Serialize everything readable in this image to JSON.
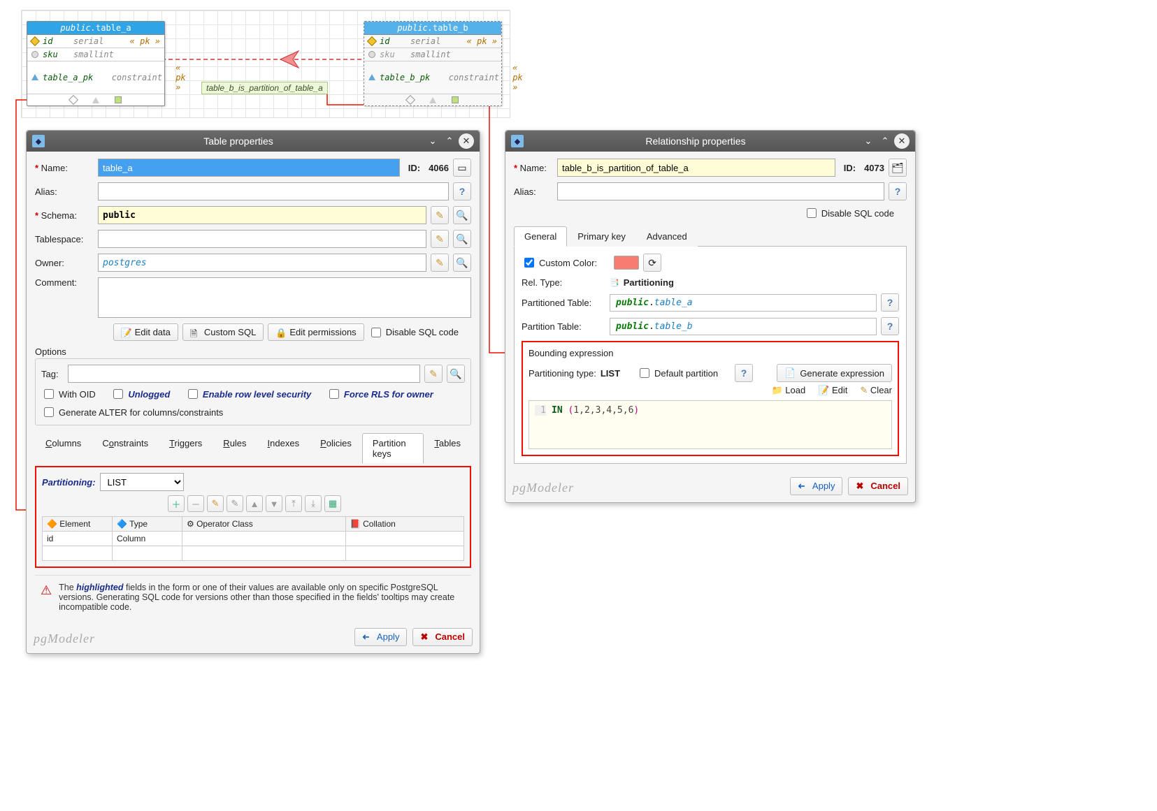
{
  "er": {
    "table_a": {
      "schema": "public.",
      "name": "table_a",
      "cols": [
        {
          "icon": "diamond",
          "name": "id",
          "type": "serial",
          "pk": "« pk »"
        },
        {
          "icon": "circle",
          "name": "sku",
          "type": "smallint",
          "pk": ""
        }
      ],
      "constraint": {
        "name": "table_a_pk",
        "type": "constraint",
        "pk": "« pk »"
      }
    },
    "table_b": {
      "schema": "public.",
      "name": "table_b",
      "cols": [
        {
          "icon": "diamond",
          "name": "id",
          "type": "serial",
          "pk": "« pk »"
        },
        {
          "icon": "circle",
          "name": "sku",
          "type": "smallint",
          "pk": ""
        }
      ],
      "constraint": {
        "name": "table_b_pk",
        "type": "constraint",
        "pk": "« pk »"
      }
    },
    "rel_label": "table_b_is_partition_of_table_a"
  },
  "tp": {
    "title": "Table properties",
    "name_label": "Name:",
    "name_value": "table_a",
    "id_label": "ID:",
    "id_value": "4066",
    "alias_label": "Alias:",
    "alias_value": "",
    "schema_label": "Schema:",
    "schema_value": "public",
    "tablespace_label": "Tablespace:",
    "tablespace_value": "",
    "owner_label": "Owner:",
    "owner_value": "postgres",
    "comment_label": "Comment:",
    "comment_value": "",
    "edit_data": "Edit data",
    "custom_sql": "Custom SQL",
    "edit_perms": "Edit permissions",
    "disable_sql": "Disable SQL code",
    "options": "Options",
    "tag": "Tag:",
    "with_oid": "With OID",
    "unlogged": "Unlogged",
    "rls": "Enable row level security",
    "force_rls": "Force RLS for owner",
    "gen_alter": "Generate ALTER for columns/constraints",
    "tabs": [
      "Columns",
      "Constraints",
      "Triggers",
      "Rules",
      "Indexes",
      "Policies",
      "Partition keys",
      "Tables"
    ],
    "partitioning_label": "Partitioning:",
    "partitioning_value": "LIST",
    "colhdr": [
      "Element",
      "Type",
      "Operator Class",
      "Collation"
    ],
    "row": [
      "id",
      "Column",
      "",
      ""
    ],
    "warn": "The highlighted fields in the form or one of their values are available only on specific PostgreSQL versions. Generating SQL code for versions other than those specified in the fields' tooltips may create incompatible code.",
    "apply": "Apply",
    "cancel": "Cancel"
  },
  "rp": {
    "title": "Relationship properties",
    "name_label": "Name:",
    "name_value": "table_b_is_partition_of_table_a",
    "id_label": "ID:",
    "id_value": "4073",
    "alias_label": "Alias:",
    "alias_value": "",
    "disable_sql": "Disable SQL code",
    "tabs": [
      "General",
      "Primary key",
      "Advanced"
    ],
    "custom_color": "Custom Color:",
    "rel_type": "Rel. Type:",
    "rel_type_value": "Partitioning",
    "ptd_label": "Partitioned Table:",
    "ptd_schema": "public",
    "ptd_table": "table_a",
    "pt_label": "Partition Table:",
    "pt_schema": "public",
    "pt_table": "table_b",
    "bexp": "Bounding expression",
    "ptype_label": "Partitioning type:",
    "ptype_value": "LIST",
    "default_part": "Default partition",
    "gen_expr": "Generate expression",
    "load": "Load",
    "edit": "Edit",
    "clear": "Clear",
    "code_kw": "IN",
    "code_args": "1,2,3,4,5,6",
    "apply": "Apply",
    "cancel": "Cancel"
  },
  "logo": "pgModeler"
}
